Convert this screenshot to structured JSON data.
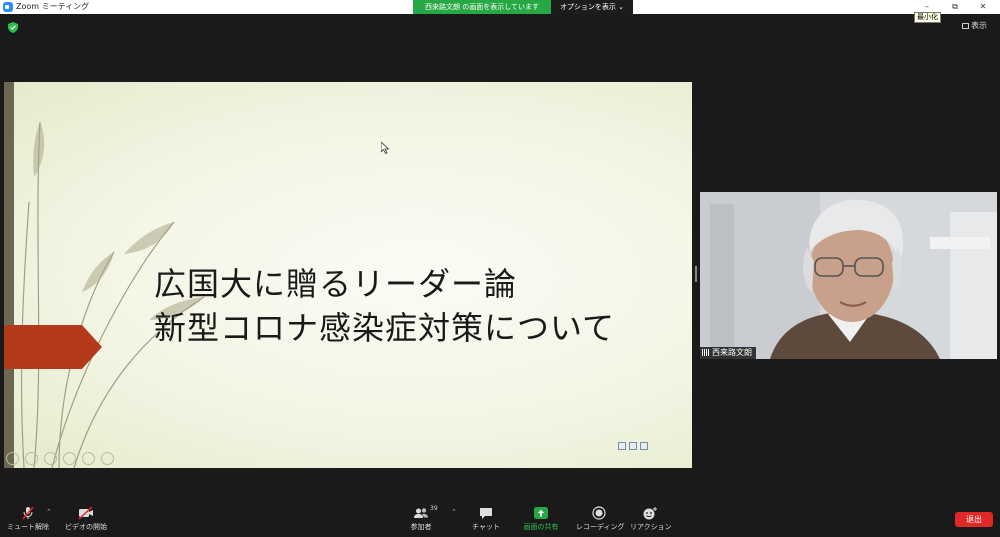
{
  "window": {
    "title": "Zoom ミーティング",
    "minimize_tooltip": "最小化"
  },
  "share_banner": {
    "text": "西来路文朗 の画面を表示しています",
    "options_label": "オプションを表示"
  },
  "view": {
    "label": "表示"
  },
  "slide": {
    "title_line1": "広国大に贈るリーダー論",
    "title_line2": "新型コロナ感染症対策について"
  },
  "video": {
    "participant_name": "西来路文朗"
  },
  "toolbar": {
    "mute_label": "ミュート解除",
    "video_label": "ビデオの開始",
    "participants_label": "参加者",
    "participants_count": "39",
    "chat_label": "チャット",
    "share_label": "画面の共有",
    "record_label": "レコーディング",
    "reactions_label": "リアクション",
    "end_label": "退出"
  },
  "colors": {
    "share_green": "#28a745",
    "end_red": "#e02828",
    "slide_accent": "#b43a1c"
  }
}
